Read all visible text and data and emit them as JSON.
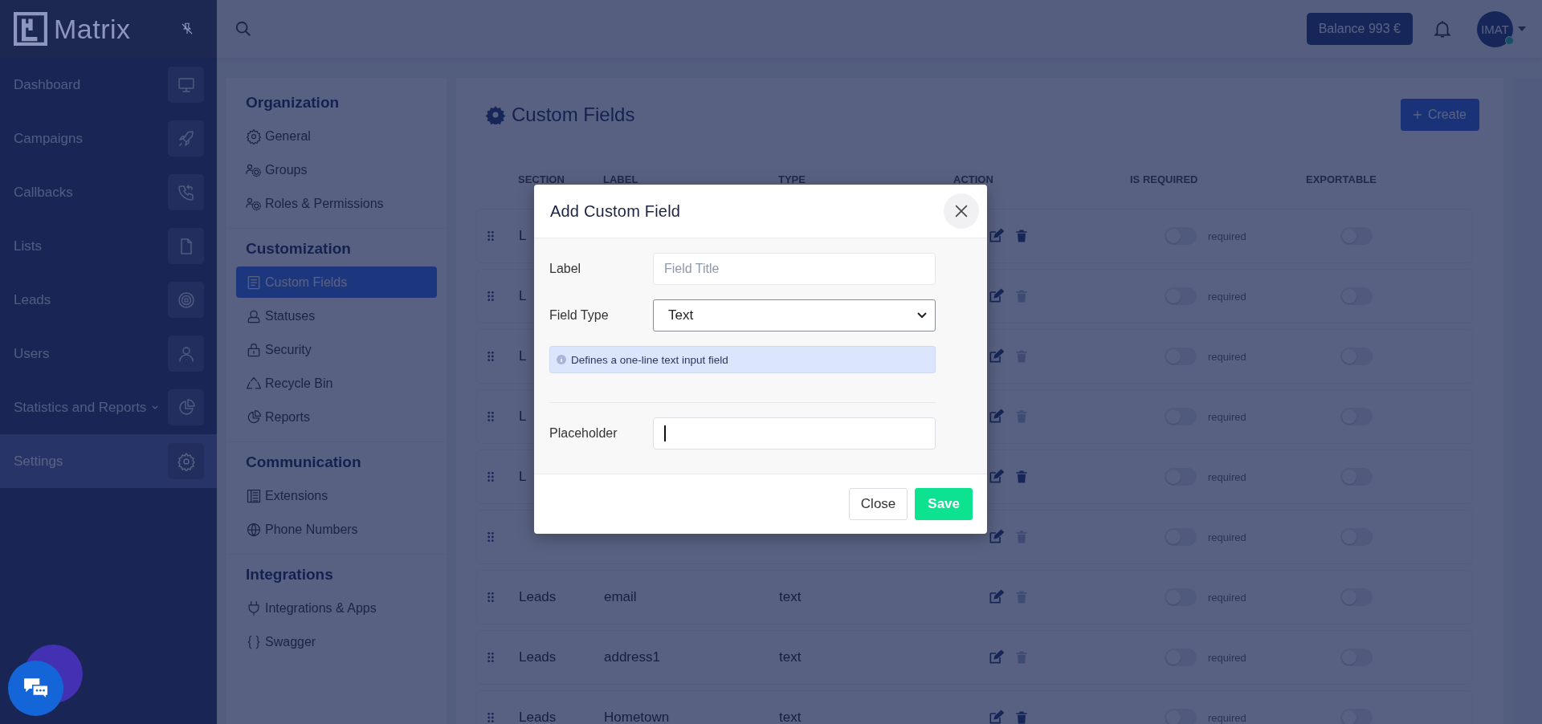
{
  "sidebar": {
    "logo": "Matrix",
    "items": [
      {
        "label": "Dashboard",
        "selected": false,
        "expandable": false
      },
      {
        "label": "Campaigns",
        "selected": false,
        "expandable": false
      },
      {
        "label": "Callbacks",
        "selected": false,
        "expandable": false
      },
      {
        "label": "Lists",
        "selected": false,
        "expandable": false
      },
      {
        "label": "Leads",
        "selected": false,
        "expandable": false
      },
      {
        "label": "Users",
        "selected": false,
        "expandable": false
      },
      {
        "label": "Statistics and Reports",
        "selected": false,
        "expandable": true
      },
      {
        "label": "Settings",
        "selected": true,
        "expandable": false
      }
    ]
  },
  "header": {
    "balance": "Balance 993 €",
    "user": "IMAT",
    "online": true
  },
  "settings_menu": [
    {
      "title": "Organization",
      "items": [
        {
          "label": "General",
          "selected": false
        },
        {
          "label": "Groups",
          "selected": false
        },
        {
          "label": "Roles & Permissions",
          "selected": false
        }
      ]
    },
    {
      "title": "Customization",
      "items": [
        {
          "label": "Custom Fields",
          "selected": true
        },
        {
          "label": "Statuses",
          "selected": false
        },
        {
          "label": "Security",
          "selected": false
        },
        {
          "label": "Recycle Bin",
          "selected": false
        },
        {
          "label": "Reports",
          "selected": false
        }
      ]
    },
    {
      "title": "Communication",
      "items": [
        {
          "label": "Extensions",
          "selected": false
        },
        {
          "label": "Phone Numbers",
          "selected": false
        }
      ]
    },
    {
      "title": "Integrations",
      "items": [
        {
          "label": "Integrations & Apps",
          "selected": false
        },
        {
          "label": "Swagger",
          "selected": false
        }
      ]
    }
  ],
  "page": {
    "title": "Custom Fields",
    "create_button": "Create"
  },
  "table": {
    "columns": [
      "SECTION",
      "LABEL",
      "TYPE",
      "ACTION",
      "IS REQUIRED",
      "EXPORTABLE"
    ],
    "rows": [
      {
        "section": "L",
        "required_text": "required",
        "required": false,
        "exportable": false,
        "removable": true
      },
      {
        "section": "L",
        "required_text": "required",
        "required": false,
        "exportable": false,
        "removable": false
      },
      {
        "section": "L",
        "required_text": "required",
        "required": false,
        "exportable": false,
        "removable": false
      },
      {
        "section": "L",
        "required_text": "required",
        "required": false,
        "exportable": false,
        "removable": false
      },
      {
        "section": "L",
        "required_text": "required",
        "required": false,
        "exportable": false,
        "removable": true
      },
      {
        "required_text": "required",
        "required": false,
        "exportable": false,
        "removable": false
      },
      {
        "section": "Leads",
        "label": "email",
        "type": "text",
        "required_text": "required",
        "required": false,
        "exportable": false,
        "removable": false
      },
      {
        "section": "Leads",
        "label": "address1",
        "type": "text",
        "required_text": "required",
        "required": false,
        "exportable": false,
        "removable": false
      },
      {
        "section": "Leads",
        "label": "Hometown",
        "type": "text",
        "required_text": "required",
        "required": false,
        "exportable": false,
        "removable": true
      }
    ]
  },
  "modal": {
    "title": "Add Custom Field",
    "fields": [
      {
        "kind": "input",
        "label": "Label",
        "placeholder": "Field Title",
        "focused": false
      },
      {
        "kind": "select",
        "label": "Field Type",
        "value": "Text"
      },
      {
        "kind": "hint",
        "text": "Defines a one-line text input field"
      },
      {
        "kind": "input",
        "label": "Placeholder",
        "focused": true
      }
    ],
    "buttons": [
      {
        "label": "Close",
        "kind": "secondary"
      },
      {
        "label": "Save",
        "kind": "primary"
      }
    ]
  }
}
